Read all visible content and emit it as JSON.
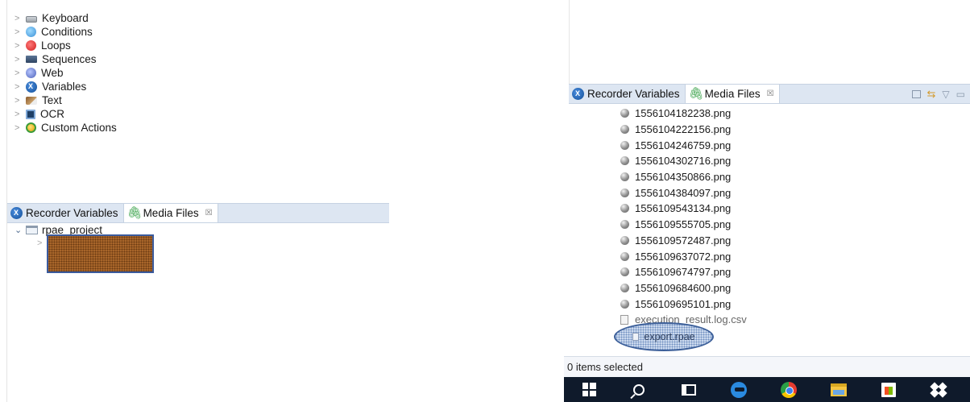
{
  "left_panel": {
    "palette": [
      {
        "label": "Keyboard",
        "icon": "keyboard-icon"
      },
      {
        "label": "Conditions",
        "icon": "conditions-icon"
      },
      {
        "label": "Loops",
        "icon": "loops-icon"
      },
      {
        "label": "Sequences",
        "icon": "sequences-icon"
      },
      {
        "label": "Web",
        "icon": "web-icon"
      },
      {
        "label": "Variables",
        "icon": "variables-icon"
      },
      {
        "label": "Text",
        "icon": "text-icon"
      },
      {
        "label": "OCR",
        "icon": "ocr-icon"
      },
      {
        "label": "Custom Actions",
        "icon": "custom-actions-icon"
      }
    ],
    "tabs": {
      "recorder_variables": "Recorder Variables",
      "media_files": "Media Files",
      "close_glyph": "☒"
    },
    "tree": {
      "root_label": "rpae_project"
    }
  },
  "right_panel": {
    "tabs": {
      "recorder_variables": "Recorder Variables",
      "media_files": "Media Files",
      "close_glyph": "☒"
    },
    "files": [
      "1556104182238.png",
      "1556104222156.png",
      "1556104246759.png",
      "1556104302716.png",
      "1556104350866.png",
      "1556104384097.png",
      "1556109543134.png",
      "1556109555705.png",
      "1556109572487.png",
      "1556109637072.png",
      "1556109674797.png",
      "1556109684600.png",
      "1556109695101.png"
    ],
    "csv_file": "execution_result.log.csv",
    "highlighted_file": "export.rpae",
    "status": "0 items selected"
  },
  "colors": {
    "tab_bar": "#dde6f2",
    "taskbar": "#0f1a2b",
    "highlight_outline": "#3c5f99"
  }
}
